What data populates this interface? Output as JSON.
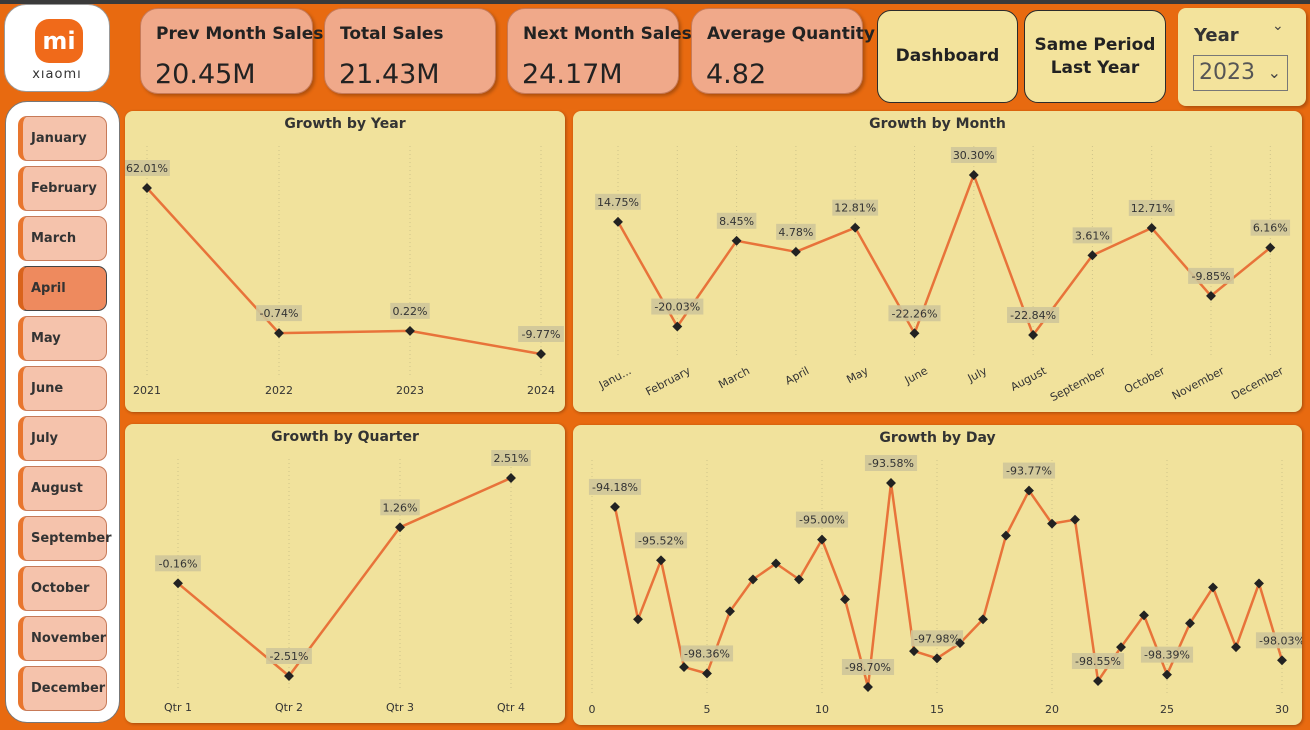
{
  "logo": {
    "mark": "mi",
    "text": "xıaomı"
  },
  "kpis": [
    {
      "label": "Prev Month Sales",
      "value": "20.45M"
    },
    {
      "label": "Total Sales",
      "value": "21.43M"
    },
    {
      "label": "Next Month Sales",
      "value": "24.17M"
    },
    {
      "label": "Average Quantity",
      "value": "4.82"
    }
  ],
  "nav": {
    "dashboard": "Dashboard",
    "same_period_1": "Same Period",
    "same_period_2": "Last Year"
  },
  "year_slicer": {
    "label": "Year",
    "selected": "2023"
  },
  "months": [
    "January",
    "February",
    "March",
    "April",
    "May",
    "June",
    "July",
    "August",
    "September",
    "October",
    "November",
    "December"
  ],
  "selected_month": "April",
  "colors": {
    "background": "#e86a10",
    "panel": "#f1e29c",
    "line": "#e8733a",
    "kpi": "#f0a98a"
  },
  "chart_data": [
    {
      "type": "line",
      "title": "Growth by Year",
      "categories": [
        "2021",
        "2022",
        "2023",
        "2024"
      ],
      "values": [
        62.01,
        -0.74,
        0.22,
        -9.77
      ],
      "labels": [
        "62.01%",
        "-0.74%",
        "0.22%",
        "-9.77%"
      ]
    },
    {
      "type": "line",
      "title": "Growth by Month",
      "categories": [
        "Janu...",
        "February",
        "March",
        "April",
        "May",
        "June",
        "July",
        "August",
        "September",
        "October",
        "November",
        "December"
      ],
      "values": [
        14.75,
        -20.03,
        8.45,
        4.78,
        12.81,
        -22.26,
        30.3,
        -22.84,
        3.61,
        12.71,
        -9.85,
        6.16
      ],
      "labels": [
        "14.75%",
        "-20.03%",
        "8.45%",
        "4.78%",
        "12.81%",
        "-22.26%",
        "30.30%",
        "-22.84%",
        "3.61%",
        "12.71%",
        "-9.85%",
        "6.16%"
      ]
    },
    {
      "type": "line",
      "title": "Growth by Quarter",
      "categories": [
        "Qtr 1",
        "Qtr 2",
        "Qtr 3",
        "Qtr 4"
      ],
      "values": [
        -0.16,
        -2.51,
        1.26,
        2.51
      ],
      "labels": [
        "-0.16%",
        "-2.51%",
        "1.26%",
        "2.51%"
      ]
    },
    {
      "type": "line",
      "title": "Growth by Day",
      "x": [
        1,
        2,
        3,
        4,
        5,
        6,
        7,
        8,
        9,
        10,
        11,
        12,
        13,
        14,
        15,
        16,
        17,
        18,
        19,
        20,
        21,
        22,
        23,
        24,
        25,
        26,
        27,
        28,
        29,
        30
      ],
      "values": [
        -94.18,
        -97.0,
        -95.52,
        -98.2,
        -98.36,
        -96.8,
        -96.0,
        -95.6,
        -96.0,
        -95.0,
        -96.5,
        -98.7,
        -93.58,
        -97.8,
        -97.98,
        -97.6,
        -97.0,
        -94.9,
        -93.77,
        -94.6,
        -94.5,
        -98.55,
        -97.7,
        -96.9,
        -98.39,
        -97.1,
        -96.2,
        -97.7,
        -96.1,
        -98.03
      ],
      "labels": {
        "1": "-94.18%",
        "3": "-95.52%",
        "5": "-98.36%",
        "10": "-95.00%",
        "12": "-98.70%",
        "13": "-93.58%",
        "15": "-97.98%",
        "19": "-93.77%",
        "22": "-98.55%",
        "25": "-98.39%",
        "30": "-98.03%"
      },
      "x_ticks": [
        "0",
        "5",
        "10",
        "15",
        "20",
        "25",
        "30"
      ]
    }
  ]
}
